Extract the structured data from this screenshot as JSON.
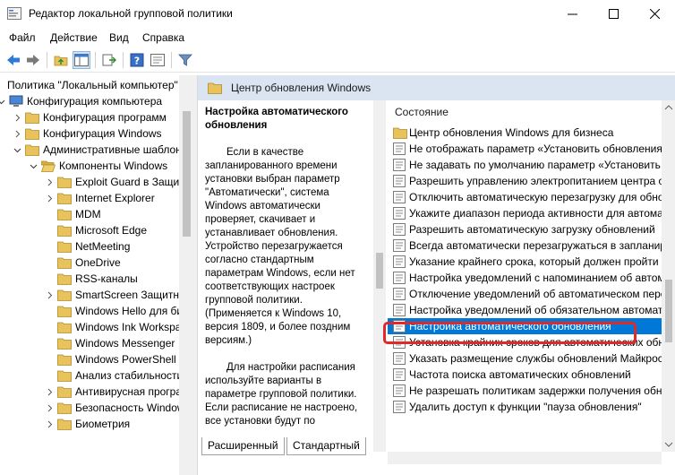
{
  "window": {
    "title": "Редактор локальной групповой политики",
    "minimize_icon": "minimize-icon",
    "maximize_icon": "maximize-icon",
    "close_icon": "close-icon"
  },
  "menu": {
    "items": [
      "Файл",
      "Действие",
      "Вид",
      "Справка"
    ]
  },
  "tree": {
    "items": [
      {
        "label": "Политика \"Локальный компьютер\"",
        "indent": 0,
        "arrow": "",
        "icon": "computer-policy-icon"
      },
      {
        "label": "Конфигурация компьютера",
        "indent": 0,
        "arrow": "down",
        "icon": "computer-icon"
      },
      {
        "label": "Конфигурация программ",
        "indent": 1,
        "arrow": "right",
        "icon": "folder-icon"
      },
      {
        "label": "Конфигурация Windows",
        "indent": 1,
        "arrow": "right",
        "icon": "folder-icon"
      },
      {
        "label": "Административные шаблоны",
        "indent": 1,
        "arrow": "down",
        "icon": "folder-icon"
      },
      {
        "label": "Компоненты Windows",
        "indent": 2,
        "arrow": "down",
        "icon": "folder-open-icon"
      },
      {
        "label": "Exploit Guard в Защитнике Windows",
        "indent": 3,
        "arrow": "right",
        "icon": "folder-icon"
      },
      {
        "label": "Internet Explorer",
        "indent": 3,
        "arrow": "right",
        "icon": "folder-icon"
      },
      {
        "label": "MDM",
        "indent": 3,
        "arrow": "",
        "icon": "folder-icon"
      },
      {
        "label": "Microsoft Edge",
        "indent": 3,
        "arrow": "",
        "icon": "folder-icon"
      },
      {
        "label": "NetMeeting",
        "indent": 3,
        "arrow": "",
        "icon": "folder-icon"
      },
      {
        "label": "OneDrive",
        "indent": 3,
        "arrow": "",
        "icon": "folder-icon"
      },
      {
        "label": "RSS-каналы",
        "indent": 3,
        "arrow": "",
        "icon": "folder-icon"
      },
      {
        "label": "SmartScreen Защитника Windows",
        "indent": 3,
        "arrow": "right",
        "icon": "folder-icon"
      },
      {
        "label": "Windows Hello для бизнеса",
        "indent": 3,
        "arrow": "",
        "icon": "folder-icon"
      },
      {
        "label": "Windows Ink Workspace",
        "indent": 3,
        "arrow": "",
        "icon": "folder-icon"
      },
      {
        "label": "Windows Messenger",
        "indent": 3,
        "arrow": "",
        "icon": "folder-icon"
      },
      {
        "label": "Windows PowerShell",
        "indent": 3,
        "arrow": "",
        "icon": "folder-icon"
      },
      {
        "label": "Анализ стабильности",
        "indent": 3,
        "arrow": "",
        "icon": "folder-icon"
      },
      {
        "label": "Антивирусная программа",
        "indent": 3,
        "arrow": "right",
        "icon": "folder-icon"
      },
      {
        "label": "Безопасность Windows",
        "indent": 3,
        "arrow": "right",
        "icon": "folder-icon"
      },
      {
        "label": "Биометрия",
        "indent": 3,
        "arrow": "right",
        "icon": "folder-icon"
      }
    ]
  },
  "header": {
    "title": "Центр обновления Windows"
  },
  "description": {
    "title": "Настройка автоматического обновления",
    "paragraphs": [
      "Если в качестве запланированного времени установки выбран параметр \"Автоматически\", система Windows автоматически проверяет, скачивает и устанавливает обновления. Устройство перезагружается согласно стандартным параметрам Windows, если нет соответствующих настроек групповой политики. (Применяется к Windows 10, версия 1809, и более поздним версиям.)",
      "Для настройки расписания используйте варианты в параметре групповой политики. Если расписание не настроено, все установки будут по"
    ]
  },
  "list": {
    "column_header": "Состояние",
    "items": [
      {
        "label": "Центр обновления Windows для бизнеса",
        "icon": "folder-icon",
        "selected": false
      },
      {
        "label": "Не отображать параметр «Установить обновления и завершить работу»",
        "icon": "policy-setting-icon",
        "selected": false
      },
      {
        "label": "Не задавать по умолчанию параметр «Установить обновления и завершить работу»",
        "icon": "policy-setting-icon",
        "selected": false
      },
      {
        "label": "Разрешить управлению электропитанием центра обновления Windows",
        "icon": "policy-setting-icon",
        "selected": false
      },
      {
        "label": "Отключить автоматическую перезагрузку для обновлений",
        "icon": "policy-setting-icon",
        "selected": false
      },
      {
        "label": "Укажите диапазон периода активности для автоматических перезагрузок",
        "icon": "policy-setting-icon",
        "selected": false
      },
      {
        "label": "Разрешить автоматическую загрузку обновлений",
        "icon": "policy-setting-icon",
        "selected": false
      },
      {
        "label": "Всегда автоматически перезагружаться в запланированное время",
        "icon": "policy-setting-icon",
        "selected": false
      },
      {
        "label": "Указание крайнего срока, который должен пройти до перезагрузки",
        "icon": "policy-setting-icon",
        "selected": false
      },
      {
        "label": "Настройка уведомлений с напоминанием об автоматической перезагрузке",
        "icon": "policy-setting-icon",
        "selected": false
      },
      {
        "label": "Отключение уведомлений об автоматическом перезапуске",
        "icon": "policy-setting-icon",
        "selected": false
      },
      {
        "label": "Настройка уведомлений об обязательном автоматическом перезапуске",
        "icon": "policy-setting-icon",
        "selected": false
      },
      {
        "label": "Настройка автоматического обновления",
        "icon": "policy-setting-icon",
        "selected": true
      },
      {
        "label": "Установка крайних сроков для автоматических обновлений",
        "icon": "policy-setting-icon",
        "selected": false
      },
      {
        "label": "Указать размещение службы обновлений Майкрософт",
        "icon": "policy-setting-icon",
        "selected": false
      },
      {
        "label": "Частота поиска автоматических обновлений",
        "icon": "policy-setting-icon",
        "selected": false
      },
      {
        "label": "Не разрешать политикам задержки получения обновлений",
        "icon": "policy-setting-icon",
        "selected": false
      },
      {
        "label": "Удалить доступ к функции \"пауза обновления\"",
        "icon": "policy-setting-icon",
        "selected": false
      }
    ]
  },
  "tabs": [
    "Расширенный",
    "Стандартный"
  ],
  "colors": {
    "selection": "#0078d7",
    "highlight_frame": "#e02a2a",
    "header_bg": "#dbe4f1",
    "folder": "#e8c25a"
  }
}
